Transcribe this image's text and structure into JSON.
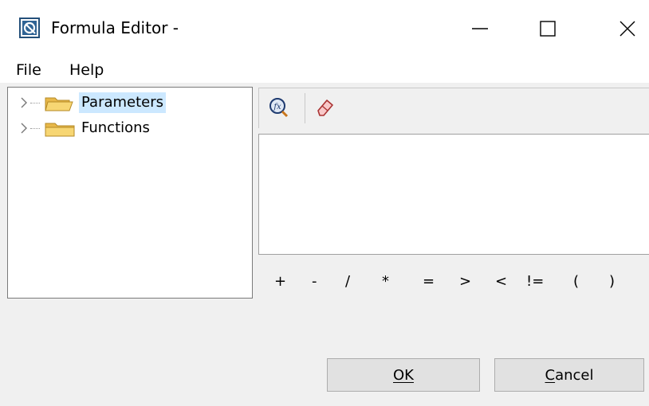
{
  "window": {
    "title": "Formula Editor -",
    "controls": {
      "minimize": "—",
      "close": "✕"
    }
  },
  "menu": {
    "items": [
      "File",
      "Help"
    ]
  },
  "tree": {
    "items": [
      {
        "label": "Parameters",
        "selected": true
      },
      {
        "label": "Functions",
        "selected": false
      }
    ]
  },
  "toolbar": {
    "buttons": [
      {
        "icon": "function-search-icon"
      },
      {
        "icon": "eraser-icon"
      }
    ]
  },
  "editor": {
    "value": ""
  },
  "operators": [
    "+",
    "-",
    "/",
    "*",
    "=",
    ">",
    "<",
    "!=",
    "(",
    ")"
  ],
  "buttons": {
    "ok": {
      "label": "OK",
      "mnemonic": "O"
    },
    "cancel": {
      "label": "Cancel",
      "mnemonic": "C"
    }
  },
  "colors": {
    "background": "#f0f0f0",
    "selection": "#cce8ff",
    "folder": "#f7d673"
  }
}
